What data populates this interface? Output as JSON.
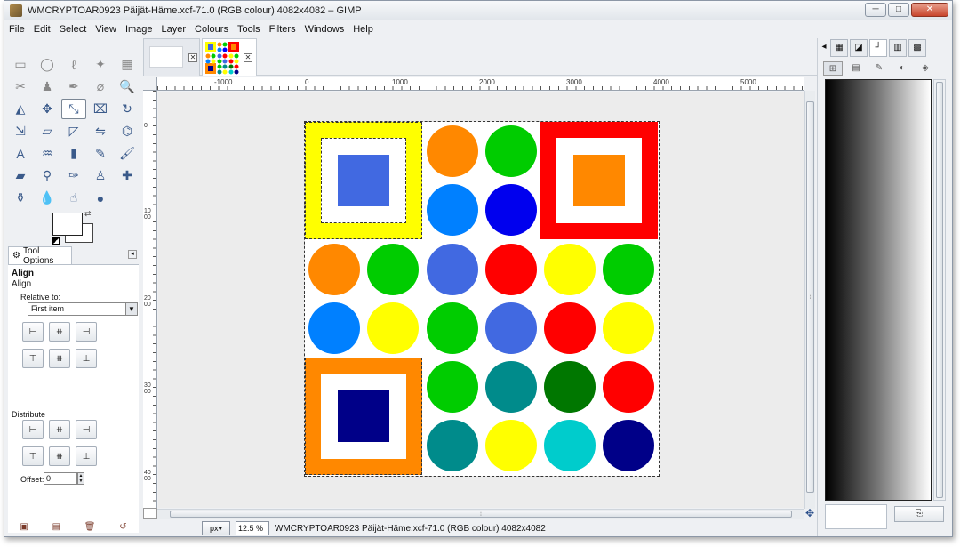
{
  "window": {
    "title": "WMCRYPTOAR0923 Päijät-Häme.xcf-71.0 (RGB colour) 4082x4082 – GIMP",
    "minimize": "─",
    "maximize": "□",
    "close": "✕"
  },
  "menu": [
    "File",
    "Edit",
    "Select",
    "View",
    "Image",
    "Layer",
    "Colours",
    "Tools",
    "Filters",
    "Windows",
    "Help"
  ],
  "toolbox": {
    "tools": [
      {
        "name": "rect-select-icon",
        "glyph": "▭"
      },
      {
        "name": "ellipse-select-icon",
        "glyph": "◯"
      },
      {
        "name": "free-select-icon",
        "glyph": "ℓ"
      },
      {
        "name": "fuzzy-select-icon",
        "glyph": "✦"
      },
      {
        "name": "color-select-icon",
        "glyph": "▦"
      },
      {
        "name": "scissors-select-icon",
        "glyph": "✂"
      },
      {
        "name": "foreground-select-icon",
        "glyph": "♟"
      },
      {
        "name": "paths-icon",
        "glyph": "✒"
      },
      {
        "name": "color-picker-icon",
        "glyph": "⌀"
      },
      {
        "name": "zoom-icon",
        "glyph": "🔍"
      },
      {
        "name": "measure-icon",
        "glyph": "◭"
      },
      {
        "name": "move-icon",
        "glyph": "✥"
      },
      {
        "name": "align-icon",
        "glyph": "⤡"
      },
      {
        "name": "crop-icon",
        "glyph": "⌧"
      },
      {
        "name": "rotate-icon",
        "glyph": "↻"
      },
      {
        "name": "scale-icon",
        "glyph": "⇲"
      },
      {
        "name": "shear-icon",
        "glyph": "▱"
      },
      {
        "name": "perspective-icon",
        "glyph": "◸"
      },
      {
        "name": "flip-icon",
        "glyph": "⇋"
      },
      {
        "name": "cage-transform-icon",
        "glyph": "⌬"
      },
      {
        "name": "text-icon",
        "glyph": "A"
      },
      {
        "name": "bucket-fill-icon",
        "glyph": "♒"
      },
      {
        "name": "blend-icon",
        "glyph": "▮"
      },
      {
        "name": "pencil-icon",
        "glyph": "✎"
      },
      {
        "name": "paintbrush-icon",
        "glyph": "🖌"
      },
      {
        "name": "eraser-icon",
        "glyph": "▰"
      },
      {
        "name": "airbrush-icon",
        "glyph": "⚲"
      },
      {
        "name": "ink-icon",
        "glyph": "✑"
      },
      {
        "name": "clone-icon",
        "glyph": "♙"
      },
      {
        "name": "heal-icon",
        "glyph": "✚"
      },
      {
        "name": "perspective-clone-icon",
        "glyph": "⚱"
      },
      {
        "name": "blur-icon",
        "glyph": "💧"
      },
      {
        "name": "smudge-icon",
        "glyph": "☝"
      },
      {
        "name": "dodge-burn-icon",
        "glyph": "●"
      }
    ]
  },
  "tool_options": {
    "tab_label": "Tool Options",
    "title": "Align",
    "subtitle": "Align",
    "relative_label": "Relative to:",
    "relative_value": "First item",
    "distribute_label": "Distribute",
    "offset_label": "Offset:",
    "offset_value": "0"
  },
  "canvas": {
    "ruler_labels": [
      "-1000",
      "0",
      "1000",
      "2000",
      "3000",
      "4000",
      "5000"
    ],
    "vruler_labels": [
      "0",
      "1000",
      "2000",
      "3000",
      "4000"
    ],
    "scroll_grip": "⁞"
  },
  "image_content": {
    "colors": {
      "yellow": "#ffff00",
      "orange": "#ff8800",
      "green": "#00cc00",
      "blue": "#0044ff",
      "azure": "#0080ff",
      "royal": "#4169e1",
      "red": "#ff0000",
      "teal": "#008b8b",
      "dark_green": "#007700",
      "navy": "#000088",
      "cyan": "#00cccc"
    }
  },
  "status": {
    "unit": "px",
    "zoom": "12.5 %",
    "text": "WMCRYPTOAR0923 Päijät-Häme.xcf-71.0 (RGB colour) 4082x4082"
  },
  "dock": {
    "tabs": [
      "▦",
      "◪",
      "┘",
      "▥",
      "▩"
    ],
    "subtabs": [
      "⊞",
      "▤",
      "✎",
      "◐",
      "◈"
    ],
    "right_arrow": "▸",
    "button": "⎘"
  }
}
